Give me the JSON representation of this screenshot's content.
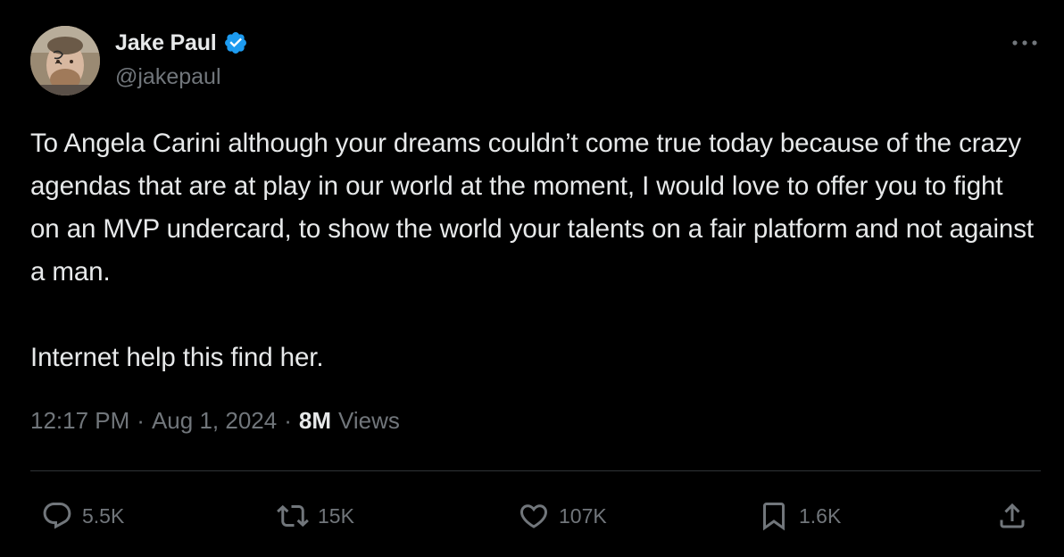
{
  "author": {
    "display_name": "Jake Paul",
    "handle": "@jakepaul",
    "verified": true,
    "verified_color": "#1d9bf0"
  },
  "tweet": {
    "paragraphs": [
      "To Angela Carini although your dreams couldn’t come true today because of the crazy agendas that are at play in our world at the moment, I would love to offer you to fight on an MVP undercard, to show the world your talents on a fair platform and not against a man.",
      "Internet help this find her."
    ],
    "time": "12:17 PM",
    "separator": "·",
    "date": "Aug 1, 2024",
    "views_count": "8M",
    "views_label": "Views"
  },
  "actions": {
    "replies": "5.5K",
    "reposts": "15K",
    "likes": "107K",
    "bookmarks": "1.6K"
  },
  "icons": {
    "more": "more-horizontal-icon",
    "reply": "reply-bubble-icon",
    "repost": "repost-arrows-icon",
    "like": "heart-icon",
    "bookmark": "bookmark-icon",
    "share": "share-upload-icon"
  },
  "colors": {
    "background": "#000000",
    "text_primary": "#e7e9ea",
    "text_secondary": "#71767b",
    "divider": "#2f3336"
  }
}
